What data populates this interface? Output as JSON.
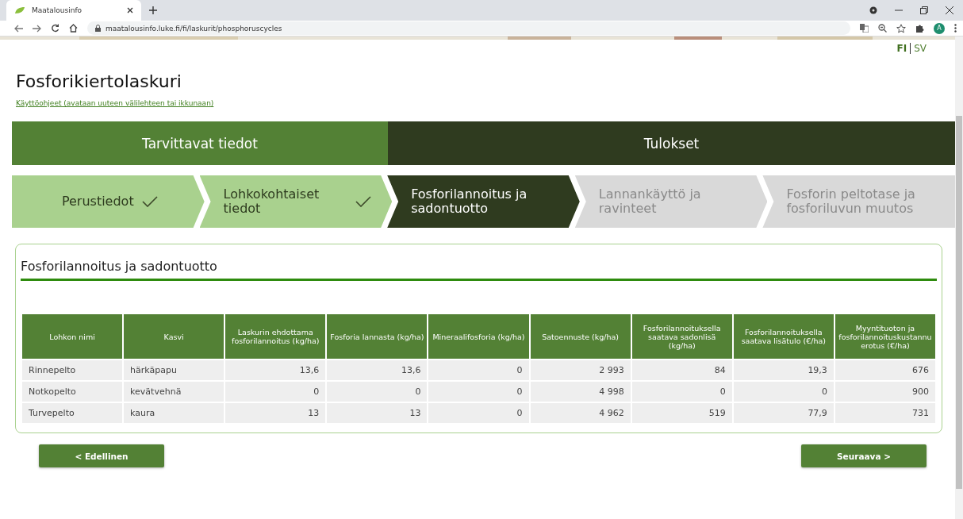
{
  "browser": {
    "tab_title": "Maatalousinfo",
    "url": "maatalousinfo.luke.fi/fi/laskurit/phosphoruscycles",
    "avatar_letter": "A"
  },
  "languages": [
    {
      "label": "FI",
      "selected": true
    },
    {
      "label": "SV",
      "selected": false
    }
  ],
  "title": "Fosforikiertolaskuri",
  "help_link": "Käyttöohjeet (avataan uuteen välilehteen tai ikkunaan)",
  "phases": [
    {
      "label": "Tarvittavat tiedot",
      "selected": false
    },
    {
      "label": "Tulokset",
      "selected": true
    }
  ],
  "steps": [
    {
      "label": "Perustiedot",
      "kind": "done"
    },
    {
      "label": "Lohkokohtaiset tiedot",
      "kind": "done"
    },
    {
      "label": "Fosforilannoitus ja sadontuotto",
      "kind": "current"
    },
    {
      "label": "Lannankäyttö ja ravinteet",
      "kind": "todo"
    },
    {
      "label": "Fosforin peltotase ja fosforiluvun muutos",
      "kind": "todo"
    }
  ],
  "section_title": "Fosforilannoitus ja sadontuotto",
  "table": {
    "columns": [
      "Lohkon nimi",
      "Kasvi",
      "Laskurin ehdottama fosforilannoitus (kg/ha)",
      "Fosforia lannasta (kg/ha)",
      "Mineraalifosforia (kg/ha)",
      "Satoennuste (kg/ha)",
      "Fosforilannoituksella saatava sadonlisä (kg/ha)",
      "Fosforilannoituksella saatava lisätulo (€/ha)",
      "Myyntituoton ja fosforilannoituskustannu erotus (€/ha)"
    ],
    "rows": [
      [
        "Rinnepelto",
        "härkäpapu",
        "13,6",
        "13,6",
        "0",
        "2 993",
        "84",
        "19,3",
        "676"
      ],
      [
        "Notkopelto",
        "kevätvehnä",
        "0",
        "0",
        "0",
        "4 998",
        "0",
        "0",
        "900"
      ],
      [
        "Turvepelto",
        "kaura",
        "13",
        "13",
        "0",
        "4 962",
        "519",
        "77,9",
        "731"
      ]
    ]
  },
  "buttons": {
    "previous": "< Edellinen",
    "next": "Seuraava >"
  }
}
